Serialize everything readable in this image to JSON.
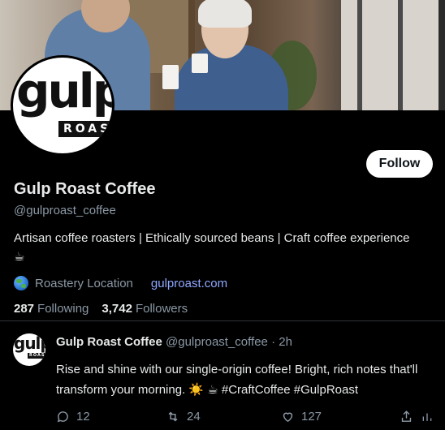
{
  "profile": {
    "name": "Gulp Roast Coffee",
    "handle": "@gulproast_coffee",
    "bio": "Artisan coffee roasters | Ethically sourced beans | Craft coffee experience ☕",
    "location": "Roastery Location",
    "website": "gulproast.com",
    "following_count": "287",
    "following_label": "Following",
    "followers_count": "3,742",
    "followers_label": "Followers",
    "follow_button": "Follow",
    "logo_word": "gulp",
    "logo_sub": "ROAST"
  },
  "tweet": {
    "author_name": "Gulp Roast Coffee",
    "author_handle": "@gulproast_coffee",
    "separator": "·",
    "time": "2h",
    "text_main": "Rise and shine with our single-origin coffee! Bright, rich notes that'll transform your morning. ☀️ ☕ ",
    "hashtags": "#CraftCoffee #GulpRoast",
    "replies": "12",
    "retweets": "24",
    "likes": "127"
  },
  "icons": {
    "location": "globe-icon",
    "reply": "reply-icon",
    "retweet": "retweet-icon",
    "like": "heart-icon",
    "share": "share-icon",
    "views": "views-icon"
  },
  "colors": {
    "background": "#000000",
    "text_primary": "#e7e9ea",
    "text_secondary": "#8b98a5",
    "link": "#8fa8ff",
    "follow_button_bg": "#ffffff"
  }
}
